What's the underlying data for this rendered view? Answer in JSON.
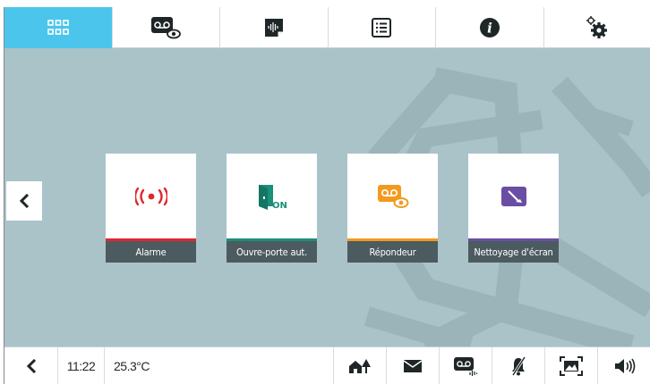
{
  "top_tabs": [
    {
      "icon": "grid-icon",
      "active": true
    },
    {
      "icon": "voicemail-eye-icon",
      "active": false
    },
    {
      "icon": "audio-note-icon",
      "active": false
    },
    {
      "icon": "list-icon",
      "active": false
    },
    {
      "icon": "info-icon",
      "active": false
    },
    {
      "icon": "settings-gears-icon",
      "active": false
    }
  ],
  "tiles": [
    {
      "label": "Alarme",
      "icon": "alarm-icon",
      "accent": "#e2262d"
    },
    {
      "label": "Ouvre-porte aut.",
      "icon": "door-on-icon",
      "accent": "#1a8f79"
    },
    {
      "label": "Répondeur",
      "icon": "answering-machine-icon",
      "accent": "#f39a1e"
    },
    {
      "label": "Nettoyage d'écran",
      "icon": "screen-cleaning-icon",
      "accent": "#6a4ea3"
    }
  ],
  "status": {
    "time": "11:22",
    "temperature": "25.3°C"
  },
  "colors": {
    "active_tab": "#4cc5ec",
    "background": "#a9c3c9",
    "label_bg": "#4c5b60"
  }
}
